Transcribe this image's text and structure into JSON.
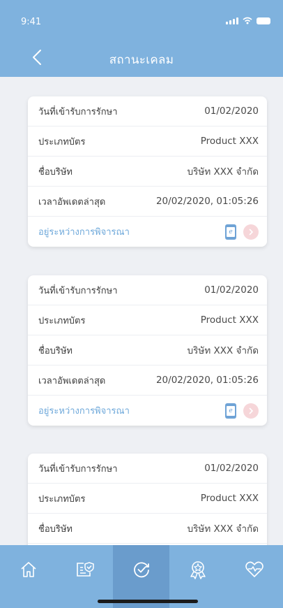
{
  "status_bar": {
    "time": "9:41"
  },
  "header": {
    "title": "สถานะเคลม"
  },
  "claims": [
    {
      "rows": [
        {
          "label": "วันที่เข้ารับการรักษา",
          "value": "01/02/2020"
        },
        {
          "label": "ประเภทบัตร",
          "value": "Product XXX"
        },
        {
          "label": "ชื่อบริษัท",
          "value": "บริษัท XXX จำกัด"
        },
        {
          "label": "เวลาอัพเดตล่าสุด",
          "value": "20/02/2020, 01:05:26"
        }
      ],
      "status": "อยู่ระหว่างการพิจารณา"
    },
    {
      "rows": [
        {
          "label": "วันที่เข้ารับการรักษา",
          "value": "01/02/2020"
        },
        {
          "label": "ประเภทบัตร",
          "value": "Product XXX"
        },
        {
          "label": "ชื่อบริษัท",
          "value": "บริษัท XXX จำกัด"
        },
        {
          "label": "เวลาอัพเดตล่าสุด",
          "value": "20/02/2020, 01:05:26"
        }
      ],
      "status": "อยู่ระหว่างการพิจารณา"
    },
    {
      "rows": [
        {
          "label": "วันที่เข้ารับการรักษา",
          "value": "01/02/2020"
        },
        {
          "label": "ประเภทบัตร",
          "value": "Product XXX"
        },
        {
          "label": "ชื่อบริษัท",
          "value": "บริษัท XXX จำกัด"
        }
      ]
    }
  ],
  "nav": {
    "items": [
      {
        "icon": "home-icon"
      },
      {
        "icon": "policy-check-icon"
      },
      {
        "icon": "claim-status-icon",
        "active": true
      },
      {
        "icon": "award-icon"
      },
      {
        "icon": "health-heart-icon"
      }
    ]
  },
  "colors": {
    "primary": "#7fb2de",
    "status": "#6ea8da",
    "background": "#eef0f4"
  }
}
